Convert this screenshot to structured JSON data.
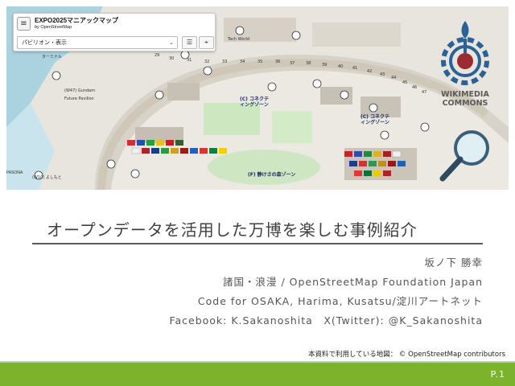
{
  "map": {
    "app_title": "EXPO2025マニアックマップ",
    "app_subtitle": "by OpenStreetMap",
    "layer_select": "パビリオン・表示",
    "icons": {
      "menu": "hamburger-menu-icon",
      "list": "list-icon",
      "location": "location-icon"
    },
    "labels": {
      "terminal": "ターミナル",
      "world": "Tech World",
      "future": "Future Pavilion",
      "connect1": "(C) コネクテ\nィングゾーン",
      "connect2": "(C) コネクテ\nィングゾーン",
      "forest": "(F) 静けさの森ゾーン",
      "pasona": "PASONA",
      "w47": "(W47) Gundam",
      "w10": "(W10) よしもと"
    },
    "ring_numbers": [
      "29",
      "30",
      "31",
      "32",
      "33",
      "34",
      "35",
      "36",
      "37",
      "38",
      "39",
      "40",
      "41",
      "42",
      "43",
      "44",
      "45",
      "46",
      "47"
    ]
  },
  "logo": {
    "wikimedia_line1": "WIKIMEDIA",
    "wikimedia_line2": "COMMONS",
    "colors": {
      "blue": "#2a6196",
      "red": "#9c2b31"
    }
  },
  "slide": {
    "title": "オープンデータを活用した万博を楽しむ事例紹介",
    "author": "坂ノ下 勝幸",
    "org": "諸国・浪漫 / OpenStreetMap Foundation Japan",
    "code": "Code for OSAKA, Harima, Kusatsu/淀川アートネット",
    "social": "Facebook: K.Sakanoshita　X(Twitter): @K_Sakanoshita",
    "credit": "本資料で利用している地図：  © OpenStreetMap contributors",
    "page": "P.1"
  },
  "colors": {
    "footer_green": "#7cb32c",
    "text_gray": "#555555"
  }
}
